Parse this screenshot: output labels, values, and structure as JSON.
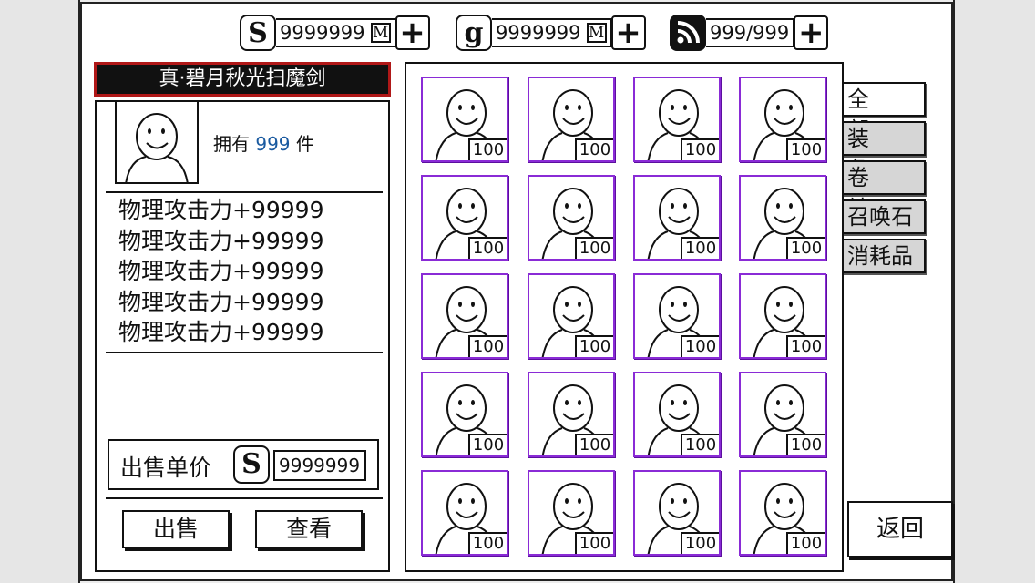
{
  "currencies": [
    {
      "icon": "silver-coin-icon",
      "glyph": "S",
      "value": "9999999",
      "badge": "M"
    },
    {
      "icon": "gold-coin-icon",
      "glyph": "g",
      "value": "9999999",
      "badge": "M"
    },
    {
      "icon": "stamina-icon",
      "glyph": "",
      "value": "999/999",
      "badge": ""
    }
  ],
  "plus_label": "+",
  "item": {
    "name": "真·碧月秋光扫魔剑",
    "own_prefix": "拥有",
    "own_count": "999",
    "own_suffix": "件",
    "stats": [
      "物理攻击力+99999",
      "物理攻击力+99999",
      "物理攻击力+99999",
      "物理攻击力+99999",
      "物理攻击力+99999"
    ],
    "price_label": "出售单价",
    "price_icon_glyph": "S",
    "price_value": "9999999",
    "sell_label": "出售",
    "view_label": "查看"
  },
  "grid": {
    "counts": [
      "100",
      "100",
      "100",
      "100",
      "100",
      "100",
      "100",
      "100",
      "100",
      "100",
      "100",
      "100",
      "100",
      "100",
      "100",
      "100",
      "100",
      "100",
      "100",
      "100"
    ]
  },
  "tabs": [
    {
      "label": "全 部",
      "active": true
    },
    {
      "label": "装 备",
      "active": false
    },
    {
      "label": "卷 轴",
      "active": false
    },
    {
      "label": "召唤石",
      "active": false
    },
    {
      "label": "消耗品",
      "active": false
    }
  ],
  "back_label": "返回",
  "colors": {
    "accent_border": "#b01818",
    "cell_border": "#8a2bd6",
    "count_blue": "#1a5aa0"
  }
}
